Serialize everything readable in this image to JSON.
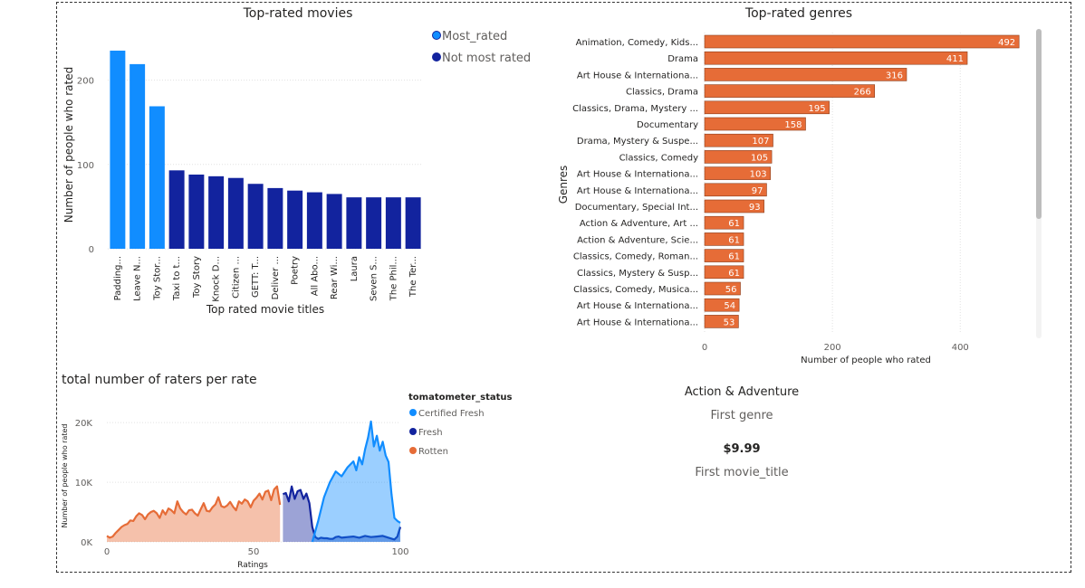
{
  "chart_data": [
    {
      "type": "bar",
      "title": "Top-rated movies",
      "xlabel": "Top rated movie titles",
      "ylabel": "Number of people who rated",
      "ylim": [
        0,
        250
      ],
      "yticks": [
        0,
        100,
        200
      ],
      "grid": true,
      "legend_position": "top-right",
      "legend": [
        {
          "label": "Most_rated",
          "color": "#118DFF"
        },
        {
          "label": "Not most rated",
          "color": "#12239E"
        }
      ],
      "categories": [
        "Padding...",
        "Leave N...",
        "Toy Stor...",
        "Taxi to t...",
        "Toy Story",
        "Knock D...",
        "Citizen ...",
        "GETT: T...",
        "Deliver ...",
        "Poetry",
        "All Abo...",
        "Rear Wi...",
        "Laura",
        "Seven S...",
        "The Phil...",
        "The Ter..."
      ],
      "values": [
        235,
        219,
        169,
        93,
        88,
        86,
        84,
        77,
        72,
        69,
        67,
        65,
        61,
        61,
        61,
        61
      ],
      "group": [
        "Most_rated",
        "Most_rated",
        "Most_rated",
        "Not most rated",
        "Not most rated",
        "Not most rated",
        "Not most rated",
        "Not most rated",
        "Not most rated",
        "Not most rated",
        "Not most rated",
        "Not most rated",
        "Not most rated",
        "Not most rated",
        "Not most rated",
        "Not most rated"
      ]
    },
    {
      "type": "bar",
      "orientation": "horizontal",
      "title": "Top-rated genres",
      "xlabel": "Number of people who rated",
      "ylabel": "Genres",
      "xlim": [
        0,
        530
      ],
      "xticks": [
        0,
        200,
        400
      ],
      "grid": true,
      "color": "#E66C37",
      "categories": [
        "Animation, Comedy, Kids...",
        "Drama",
        "Art House & Internationa...",
        "Classics, Drama",
        "Classics, Drama, Mystery ...",
        "Documentary",
        "Drama, Mystery & Suspe...",
        "Classics, Comedy",
        "Art House & Internationa...",
        "Art House & Internationa...",
        "Documentary, Special Int...",
        "Action & Adventure, Art ...",
        "Action & Adventure, Scie...",
        "Classics, Comedy, Roman...",
        "Classics, Mystery & Susp...",
        "Classics, Comedy, Musica...",
        "Art House & Internationa...",
        "Art House & Internationa..."
      ],
      "values": [
        492,
        411,
        316,
        266,
        195,
        158,
        107,
        105,
        103,
        97,
        93,
        61,
        61,
        61,
        61,
        56,
        54,
        53
      ]
    },
    {
      "type": "area",
      "title": "total number of raters per rate",
      "xlabel": "Ratings",
      "ylabel": "Number of people who rated",
      "xlim": [
        0,
        100
      ],
      "ylim": [
        0,
        22000
      ],
      "xticks": [
        0,
        50,
        100
      ],
      "yticks": [
        {
          "v": 0,
          "label": "0K"
        },
        {
          "v": 10000,
          "label": "10K"
        },
        {
          "v": 20000,
          "label": "20K"
        }
      ],
      "legend_title": "tomatometer_status",
      "legend_position": "right",
      "series": [
        {
          "name": "Certified Fresh",
          "color": "#118DFF",
          "x": [
            70,
            72,
            74,
            76,
            78,
            80,
            82,
            84,
            85,
            86,
            87,
            88,
            89,
            90,
            91,
            92,
            93,
            94,
            95,
            96,
            97,
            98,
            99,
            100
          ],
          "values": [
            0,
            3500,
            7500,
            10000,
            11800,
            11000,
            12500,
            13500,
            12000,
            14200,
            13000,
            15500,
            17500,
            20200,
            16000,
            17800,
            15300,
            16800,
            14500,
            13400,
            8000,
            4000,
            3500,
            3200
          ]
        },
        {
          "name": "Fresh",
          "color": "#12239E",
          "x": [
            60,
            61,
            62,
            63,
            64,
            65,
            66,
            67,
            68,
            69,
            70,
            71,
            72,
            73,
            74,
            75,
            76,
            77,
            78,
            79,
            80,
            82,
            84,
            86,
            88,
            90,
            92,
            94,
            96,
            98,
            99,
            100
          ],
          "values": [
            8000,
            8200,
            6800,
            9300,
            7200,
            8500,
            8700,
            7200,
            8100,
            6500,
            2500,
            800,
            500,
            700,
            600,
            600,
            500,
            500,
            800,
            900,
            700,
            800,
            900,
            700,
            1000,
            800,
            900,
            1000,
            700,
            400,
            900,
            2500
          ]
        },
        {
          "name": "Rotten",
          "color": "#E66C37",
          "x": [
            0,
            1,
            2,
            3,
            4,
            5,
            6,
            7,
            8,
            9,
            10,
            11,
            12,
            13,
            14,
            15,
            16,
            17,
            18,
            19,
            20,
            21,
            22,
            23,
            24,
            25,
            26,
            27,
            28,
            29,
            30,
            31,
            32,
            33,
            34,
            35,
            36,
            37,
            38,
            39,
            40,
            41,
            42,
            43,
            44,
            45,
            46,
            47,
            48,
            49,
            50,
            51,
            52,
            53,
            54,
            55,
            56,
            57,
            58,
            59
          ],
          "values": [
            1000,
            700,
            900,
            1500,
            2000,
            2500,
            2800,
            3000,
            3600,
            3500,
            4300,
            4800,
            4500,
            3800,
            4600,
            5000,
            5200,
            4800,
            4000,
            5300,
            4600,
            5600,
            5300,
            4800,
            6800,
            5600,
            5000,
            4600,
            5300,
            5400,
            4800,
            4400,
            5500,
            6500,
            5200,
            5100,
            5800,
            6300,
            7500,
            6000,
            5800,
            6100,
            6700,
            5900,
            5300,
            6800,
            6400,
            7100,
            6800,
            5800,
            6900,
            7400,
            8100,
            7100,
            8400,
            8600,
            7000,
            8800,
            9300,
            6200
          ]
        }
      ]
    }
  ],
  "cards": [
    {
      "value": "Action & Adventure",
      "label": "First genre"
    },
    {
      "value": "$9.99",
      "label": "First movie_title"
    }
  ]
}
